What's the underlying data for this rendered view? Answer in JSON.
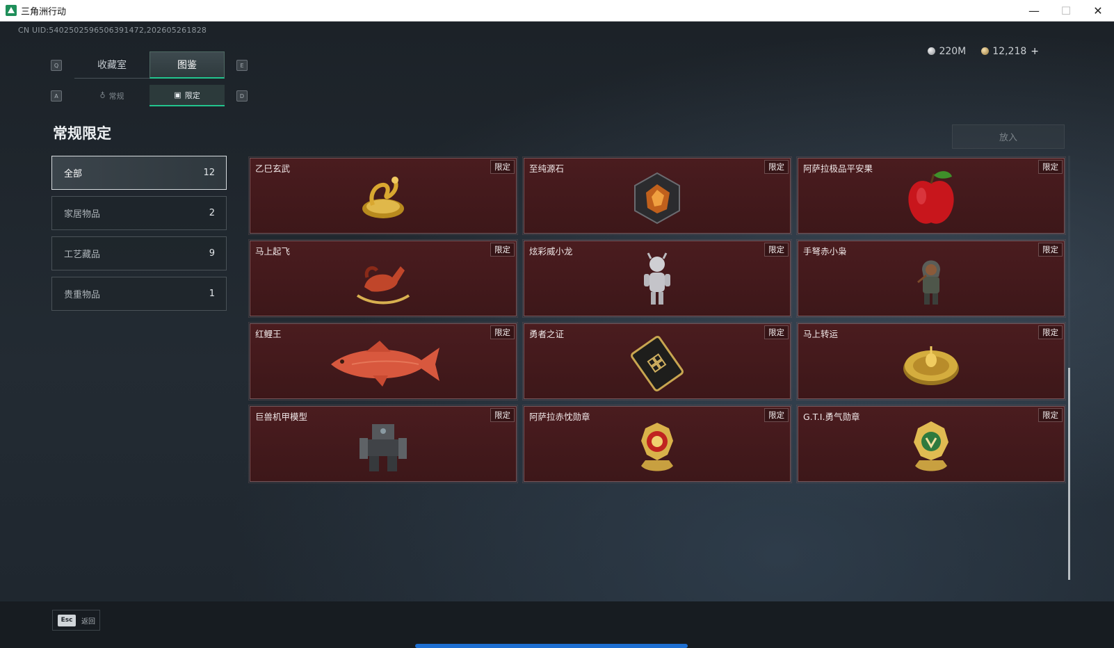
{
  "window": {
    "title": "三角洲行动",
    "minimize_label": "—",
    "maximize_label": "☐",
    "close_label": "✕"
  },
  "uid": "CN UID:5402502596506391472,202605261828",
  "currency": {
    "silver": "220M",
    "gold": "12,218",
    "add_label": "+"
  },
  "tabs": {
    "prev_key": "Q",
    "next_key": "E",
    "items": [
      {
        "label": "收藏室",
        "active": false
      },
      {
        "label": "图鉴",
        "active": true
      }
    ]
  },
  "subtabs": {
    "prev_key": "A",
    "next_key": "D",
    "items": [
      {
        "label": "常规",
        "active": false
      },
      {
        "label": "限定",
        "active": true
      }
    ]
  },
  "section_title": "常规限定",
  "put_button": "放入",
  "categories": [
    {
      "label": "全部",
      "count": "12",
      "active": true
    },
    {
      "label": "家居物品",
      "count": "2",
      "active": false
    },
    {
      "label": "工艺藏品",
      "count": "9",
      "active": false
    },
    {
      "label": "贵重物品",
      "count": "1",
      "active": false
    }
  ],
  "items": [
    {
      "name": "乙巳玄武",
      "badge": "限定",
      "icon": "golden-serpent-tortoise"
    },
    {
      "name": "至纯源石",
      "badge": "限定",
      "icon": "pure-source-stone"
    },
    {
      "name": "阿萨拉极品平安果",
      "badge": "限定",
      "icon": "red-apple"
    },
    {
      "name": "马上起飞",
      "badge": "限定",
      "icon": "rocking-horse"
    },
    {
      "name": "炫彩威小龙",
      "badge": "限定",
      "icon": "dragon-figurine"
    },
    {
      "name": "手弩赤小枭",
      "badge": "限定",
      "icon": "hooded-figurine"
    },
    {
      "name": "红鲤王",
      "badge": "限定",
      "icon": "red-carp"
    },
    {
      "name": "勇者之证",
      "badge": "限定",
      "icon": "brave-card"
    },
    {
      "name": "马上转运",
      "badge": "限定",
      "icon": "golden-wheel"
    },
    {
      "name": "巨兽机甲模型",
      "badge": "限定",
      "icon": "mech-model"
    },
    {
      "name": "阿萨拉赤忱勋章",
      "badge": "限定",
      "icon": "red-medal"
    },
    {
      "name": "G.T.I.勇气勋章",
      "badge": "限定",
      "icon": "green-medal"
    }
  ],
  "footer": {
    "esc_key": "Esc",
    "back_label": "返回"
  },
  "colors": {
    "accent": "#22c58e",
    "card_bg": "#451a1d",
    "progress": "#1e6fd1"
  }
}
